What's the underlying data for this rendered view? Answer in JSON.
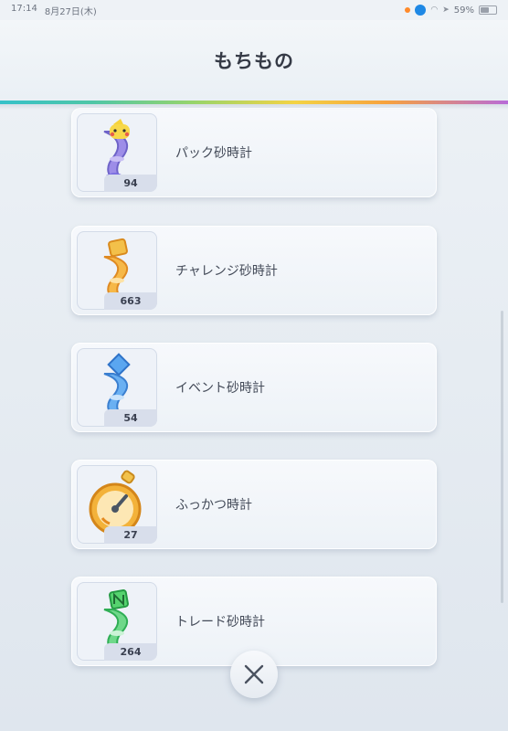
{
  "status_bar": {
    "time": "17:14",
    "date": "8月27日(木)",
    "battery": "59%",
    "battery_level": 0.59
  },
  "header": {
    "title": "もちもの"
  },
  "items": [
    {
      "name": "パック砂時計",
      "count": "94",
      "icon": "pack-hourglass-icon",
      "accent": "#8f7be0"
    },
    {
      "name": "チャレンジ砂時計",
      "count": "663",
      "icon": "challenge-hourglass-icon",
      "accent": "#f0a43a"
    },
    {
      "name": "イベント砂時計",
      "count": "54",
      "icon": "event-hourglass-icon",
      "accent": "#4a8fe0"
    },
    {
      "name": "ふっかつ時計",
      "count": "27",
      "icon": "revival-clock-icon",
      "accent": "#e89a2a"
    },
    {
      "name": "トレード砂時計",
      "count": "264",
      "icon": "trade-hourglass-icon",
      "accent": "#3fbf5f"
    }
  ],
  "close": {
    "icon": "close-icon"
  }
}
